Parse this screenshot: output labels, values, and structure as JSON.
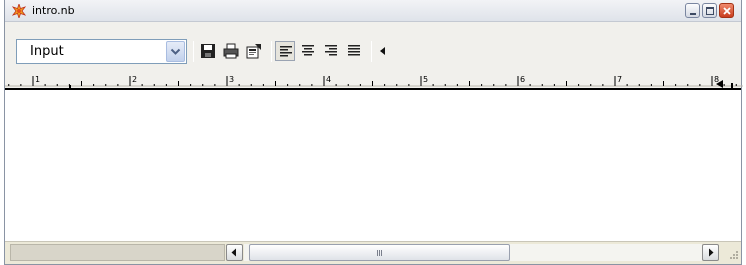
{
  "window": {
    "title": "intro.nb",
    "icon": "mathematica-star-icon"
  },
  "toolbar": {
    "style_select": {
      "value": "Input"
    },
    "buttons": [
      {
        "name": "save",
        "icon": "floppy-disk-icon"
      },
      {
        "name": "print",
        "icon": "printer-icon"
      },
      {
        "name": "properties",
        "icon": "properties-icon"
      },
      {
        "name": "align-left",
        "icon": "align-left-icon",
        "active": true
      },
      {
        "name": "align-center",
        "icon": "align-center-icon"
      },
      {
        "name": "align-right",
        "icon": "align-right-icon"
      },
      {
        "name": "justify",
        "icon": "justify-icon"
      },
      {
        "name": "collapse",
        "icon": "triangle-left-icon"
      }
    ]
  },
  "ruler": {
    "labels": [
      "1",
      "2",
      "3",
      "4",
      "5",
      "6",
      "7",
      "8"
    ]
  },
  "colors": {
    "chrome": "#ece9d8",
    "title_bar": "#dfe3ea",
    "close_button": "#c83d1f"
  }
}
